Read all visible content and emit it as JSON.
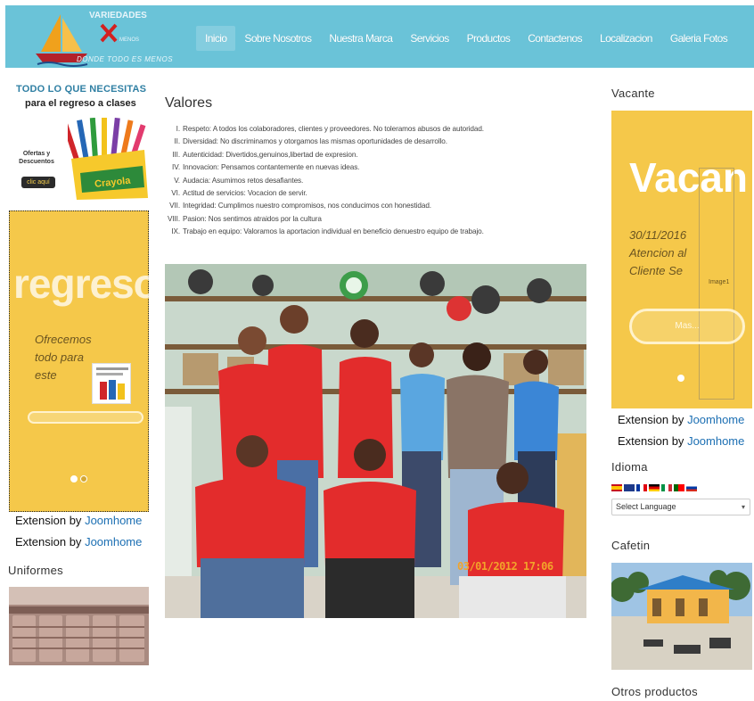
{
  "header": {
    "logo": {
      "brand_top": "VARIEDADES",
      "brand_mid": "MENOS",
      "tagline": "DONDE TODO ES MENOS"
    },
    "nav": [
      {
        "label": "Inicio",
        "active": true
      },
      {
        "label": "Sobre Nosotros"
      },
      {
        "label": "Nuestra Marca"
      },
      {
        "label": "Servicios"
      },
      {
        "label": "Productos"
      },
      {
        "label": "Contactenos"
      },
      {
        "label": "Localizacion"
      },
      {
        "label": "Galeria Fotos"
      }
    ],
    "accent_color": "#6ac3d8"
  },
  "left": {
    "promo": {
      "headline": "TODO LO QUE NECESITAS",
      "subhead": "para el regreso a clases",
      "ofertas": "Ofertas y Descuentos",
      "button": "clic aquí",
      "box_brand": "Crayola"
    },
    "slider": {
      "big_text": "regreso",
      "caption": "Ofrecemos todo para este",
      "bg_color": "#f5c84a"
    },
    "extension_line": "Extension by",
    "extension_link": "Joomhome",
    "uniformes_title": "Uniformes"
  },
  "main": {
    "title": "Valores",
    "values": [
      {
        "num": "I.",
        "text": "Respeto: A todos los colaboradores, clientes y proveedores. No toleramos abusos de autoridad."
      },
      {
        "num": "II.",
        "text": "Diversidad: No discriminamos y otorgamos las mismas oportunidades de desarrollo."
      },
      {
        "num": "III.",
        "text": "Autenticidad: Divertidos,genuinos,libertad de expresion."
      },
      {
        "num": "IV.",
        "text": "Innovacion: Pensamos contantemente en nuevas ideas."
      },
      {
        "num": "V.",
        "text": "Audacia:  Asumimos  retos desafiantes."
      },
      {
        "num": "VI.",
        "text": "Actitud de servicios: Vocacion de servir."
      },
      {
        "num": "VII.",
        "text": "Integridad: Cumplimos nuestro compromisos, nos conducimos con honestidad."
      },
      {
        "num": "VIII.",
        "text": "Pasion: Nos sentimos atraidos por la cultura"
      },
      {
        "num": "IX.",
        "text": "Trabajo en equipo: Valoramos la aportacion individual en beneficio denuestro equipo de trabajo."
      }
    ],
    "photo_stamp": "03/01/2012 17:06"
  },
  "right": {
    "vacante_title": "Vacante",
    "slider": {
      "big_text": "Vacan",
      "caption": "30/11/2016 Atencion al Cliente Se",
      "image_label": "Image1",
      "button": "Mas..."
    },
    "extension_line": "Extension by",
    "extension_link": "Joomhome",
    "idioma_title": "Idioma",
    "select_language": "Select Language",
    "cafetin_title": "Cafetin",
    "otros_title": "Otros productos"
  }
}
